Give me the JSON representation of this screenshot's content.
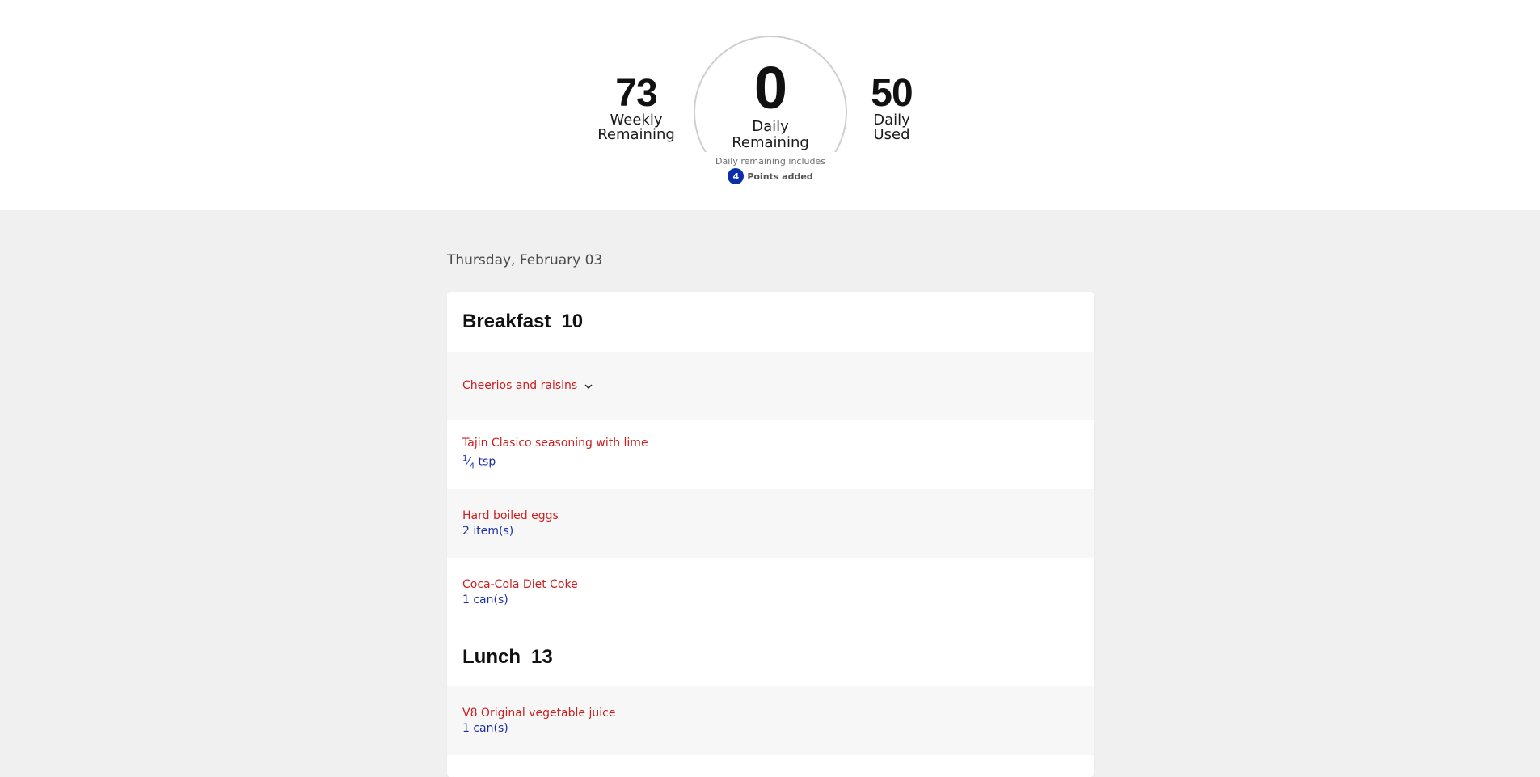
{
  "summary": {
    "weekly": {
      "value": "73",
      "label_line1": "Weekly",
      "label_line2": "Remaining"
    },
    "daily": {
      "value": "0",
      "label_line1": "Daily",
      "label_line2": "Remaining"
    },
    "used": {
      "value": "50",
      "label_line1": "Daily",
      "label_line2": "Used"
    },
    "includes_text": "Daily remaining includes",
    "points_added_count": "4",
    "points_added_label": "Points added"
  },
  "date": "Thursday, February 03",
  "meals": {
    "breakfast": {
      "name": "Breakfast",
      "points": "10",
      "items": [
        {
          "food": "Cheerios and raisins",
          "amount": ""
        },
        {
          "food": "Tajin Clasico seasoning with lime",
          "amount_whole": "1",
          "amount_frac": "4",
          "amount_unit": "tsp"
        },
        {
          "food": "Hard boiled eggs",
          "amount": "2 item(s)"
        },
        {
          "food": "Coca-Cola Diet Coke",
          "amount": "1 can(s)"
        }
      ]
    },
    "lunch": {
      "name": "Lunch",
      "points": "13",
      "items": [
        {
          "food": "V8 Original vegetable juice",
          "amount": "1 can(s)"
        }
      ]
    }
  },
  "colors": {
    "food_link": "#cc1f1f",
    "amount": "#1b2fa0",
    "badge": "#0a2fa8",
    "page_bg": "#f0f0f0"
  }
}
